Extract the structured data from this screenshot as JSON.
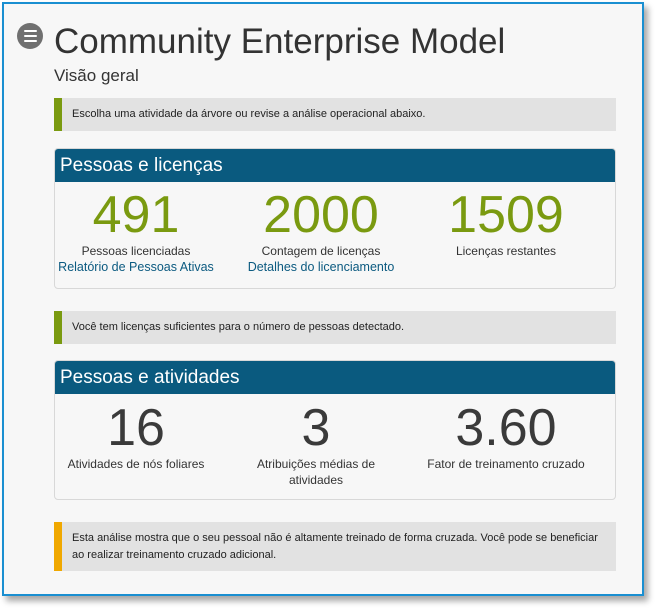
{
  "header": {
    "title": "Community Enterprise Model",
    "subtitle": "Visão geral"
  },
  "notices": {
    "intro": "Escolha uma atividade da árvore ou revise a análise operacional abaixo.",
    "licenses_ok": "Você tem licenças suficientes para o número de pessoas detectado.",
    "cross_training": "Esta análise mostra que o seu pessoal não é altamente treinado de forma cruzada. Você pode se beneficiar ao realizar treinamento cruzado adicional."
  },
  "licenses_panel": {
    "title": "Pessoas e licenças",
    "metrics": [
      {
        "value": "491",
        "label": "Pessoas licenciadas",
        "link": "Relatório de Pessoas Ativas"
      },
      {
        "value": "2000",
        "label": "Contagem de licenças",
        "link": "Detalhes do licenciamento"
      },
      {
        "value": "1509",
        "label": "Licenças restantes"
      }
    ]
  },
  "activities_panel": {
    "title": "Pessoas e atividades",
    "metrics": [
      {
        "value": "16",
        "label": "Atividades de nós foliares"
      },
      {
        "value": "3",
        "label": "Atribuições médias de atividades"
      },
      {
        "value": "3.60",
        "label": "Fator de treinamento cruzado"
      }
    ]
  },
  "colors": {
    "accent_green": "#7a9a10",
    "warning_yellow": "#f0a800",
    "panel_header": "#0a5a7f",
    "window_border": "#1a8fd1"
  },
  "icons": {
    "menu": "hamburger-menu-icon"
  }
}
